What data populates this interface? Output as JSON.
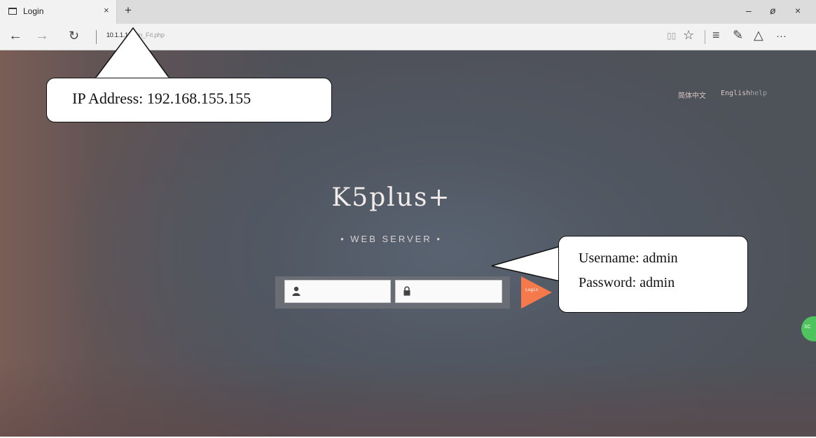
{
  "browser": {
    "tab": {
      "title": "Login",
      "close": "×"
    },
    "new_tab": "+",
    "window": {
      "minimize": "–",
      "maximize": "ơ",
      "close": "×"
    },
    "nav": {
      "back": "←",
      "forward": "→",
      "refresh": "↻"
    },
    "address": {
      "visible": "10.1.1.1",
      "rest": "/login_Fri.php"
    },
    "icons": {
      "reading": "▯▯",
      "favorite": "☆",
      "hub": "≡",
      "note": "✎",
      "share": "△",
      "more": "···"
    }
  },
  "page": {
    "languages": [
      "简体中文",
      "English",
      "help"
    ],
    "logo": "K5plus+",
    "subtitle": "• WEB SERVER •",
    "username_field": {
      "value": ""
    },
    "password_field": {
      "value": ""
    },
    "login_button": "Login",
    "side_circle": "SC"
  },
  "annotations": {
    "ip": "IP Address: 192.168.155.155",
    "username": "Username: admin",
    "password": "Password: admin"
  },
  "colors": {
    "login_button": "#f47a4c",
    "panel": "#6a6d74",
    "side_circle": "#4fc45e"
  }
}
